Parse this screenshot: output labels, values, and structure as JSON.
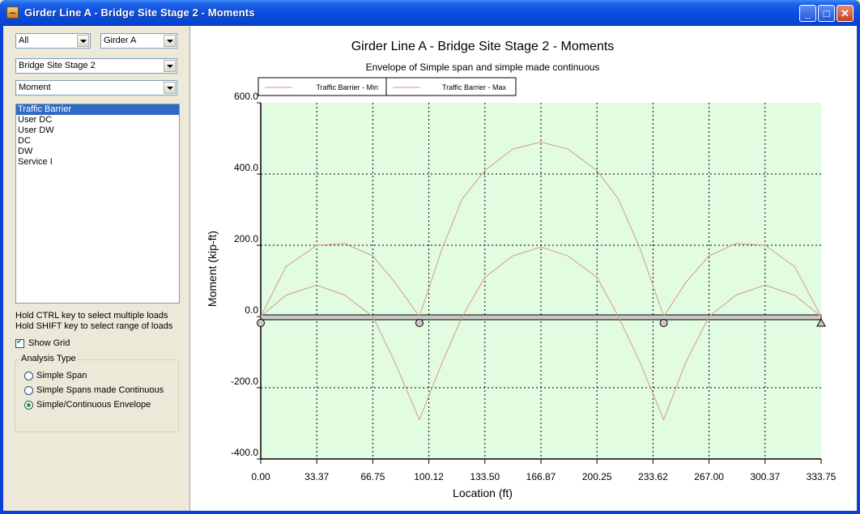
{
  "window": {
    "title": "Girder Line A - Bridge Site Stage 2 - Moments",
    "buttons": {
      "minimize": "_",
      "maximize": "□",
      "close": "✕"
    }
  },
  "controls": {
    "span_combo": "All",
    "girder_combo": "Girder A",
    "stage_combo": "Bridge Site Stage 2",
    "action_combo": "Moment"
  },
  "loads": {
    "items": [
      "Traffic Barrier",
      "User DC",
      "User DW",
      "DC",
      "DW",
      "Service I"
    ],
    "selected_index": 0
  },
  "hints": {
    "ctrl": "Hold CTRL key to select multiple loads",
    "shift": "Hold SHIFT key to select range of loads"
  },
  "show_grid": {
    "label": "Show Grid",
    "checked": true
  },
  "analysis": {
    "title": "Analysis Type",
    "options": [
      "Simple Span",
      "Simple Spans made Continuous",
      "Simple/Continuous Envelope"
    ],
    "selected_index": 2
  },
  "colors": {
    "plot_bg": "#e2fce2",
    "series": "#d39a8e",
    "accent": "#316ac5"
  },
  "chart_data": {
    "type": "line",
    "title": "Girder Line A - Bridge Site Stage 2 - Moments",
    "subtitle": "Envelope of Simple span and simple made continuous",
    "xlabel": "Location (ft)",
    "ylabel": "Moment (kip-ft)",
    "xlim": [
      0,
      333.75
    ],
    "ylim": [
      -400,
      600
    ],
    "xticks": [
      "0.00",
      "33.37",
      "66.75",
      "100.12",
      "133.50",
      "166.87",
      "200.25",
      "233.62",
      "267.00",
      "300.37",
      "333.75"
    ],
    "yticks": [
      "600.0",
      "400.0",
      "200.0",
      "0.0",
      "-200.0",
      "-400.0"
    ],
    "ytick_values": [
      600,
      400,
      200,
      0,
      -200,
      -400
    ],
    "grid": true,
    "legend_position": "top-left",
    "supports": [
      0,
      94.5,
      240,
      333.75
    ],
    "series": [
      {
        "name": "Traffic Barrier - Min",
        "x": [
          0,
          15,
          33.4,
          50,
          66.75,
          80,
          94.5,
          108,
          120,
          133.5,
          150,
          166.87,
          183,
          200.25,
          213,
          226,
          240,
          253,
          267,
          283,
          300.37,
          318,
          333.75
        ],
        "y": [
          0,
          60,
          88,
          60,
          0,
          -130,
          -290,
          -130,
          0,
          110,
          170,
          195,
          170,
          110,
          0,
          -130,
          -290,
          -130,
          0,
          60,
          88,
          60,
          0
        ]
      },
      {
        "name": "Traffic Barrier - Max",
        "x": [
          0,
          15,
          33.4,
          50,
          66.75,
          80,
          94.5,
          108,
          120,
          133.5,
          150,
          166.87,
          183,
          200.25,
          213,
          226,
          240,
          253,
          267,
          283,
          300.37,
          318,
          333.75
        ],
        "y": [
          0,
          140,
          200,
          205,
          170,
          95,
          0,
          190,
          330,
          410,
          470,
          490,
          470,
          410,
          330,
          190,
          0,
          95,
          170,
          205,
          200,
          140,
          0
        ]
      }
    ]
  }
}
